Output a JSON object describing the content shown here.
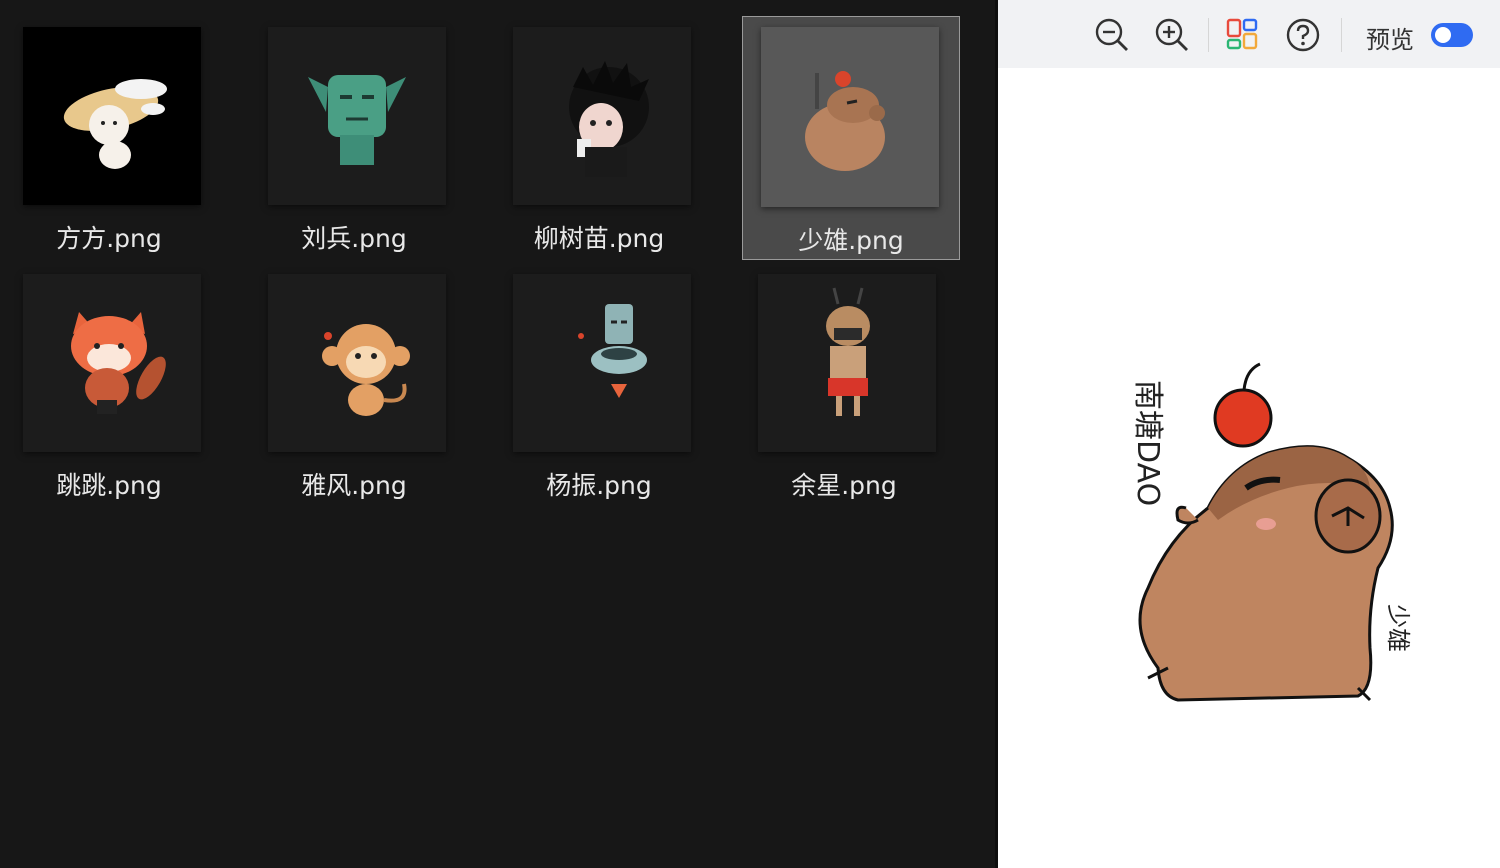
{
  "files": [
    {
      "name": "方方.png",
      "selected": false
    },
    {
      "name": "刘兵.png",
      "selected": false
    },
    {
      "name": "柳树苗.png",
      "selected": false
    },
    {
      "name": "少雄.png",
      "selected": true
    },
    {
      "name": "跳跳.png",
      "selected": false
    },
    {
      "name": "雅风.png",
      "selected": false
    },
    {
      "name": "杨振.png",
      "selected": false
    },
    {
      "name": "余星.png",
      "selected": false
    }
  ],
  "toolbar": {
    "icons": [
      "zoom-out-icon",
      "zoom-in-icon",
      "layout-icon",
      "help-icon"
    ],
    "preview_label": "预览",
    "preview_toggle_on": true
  },
  "preview": {
    "vertical_text": "南塘DAO",
    "signature": "少雄"
  },
  "colors": {
    "accent": "#2f6bf2",
    "background": "#171717",
    "selected_tile": "#4a4a4a"
  }
}
